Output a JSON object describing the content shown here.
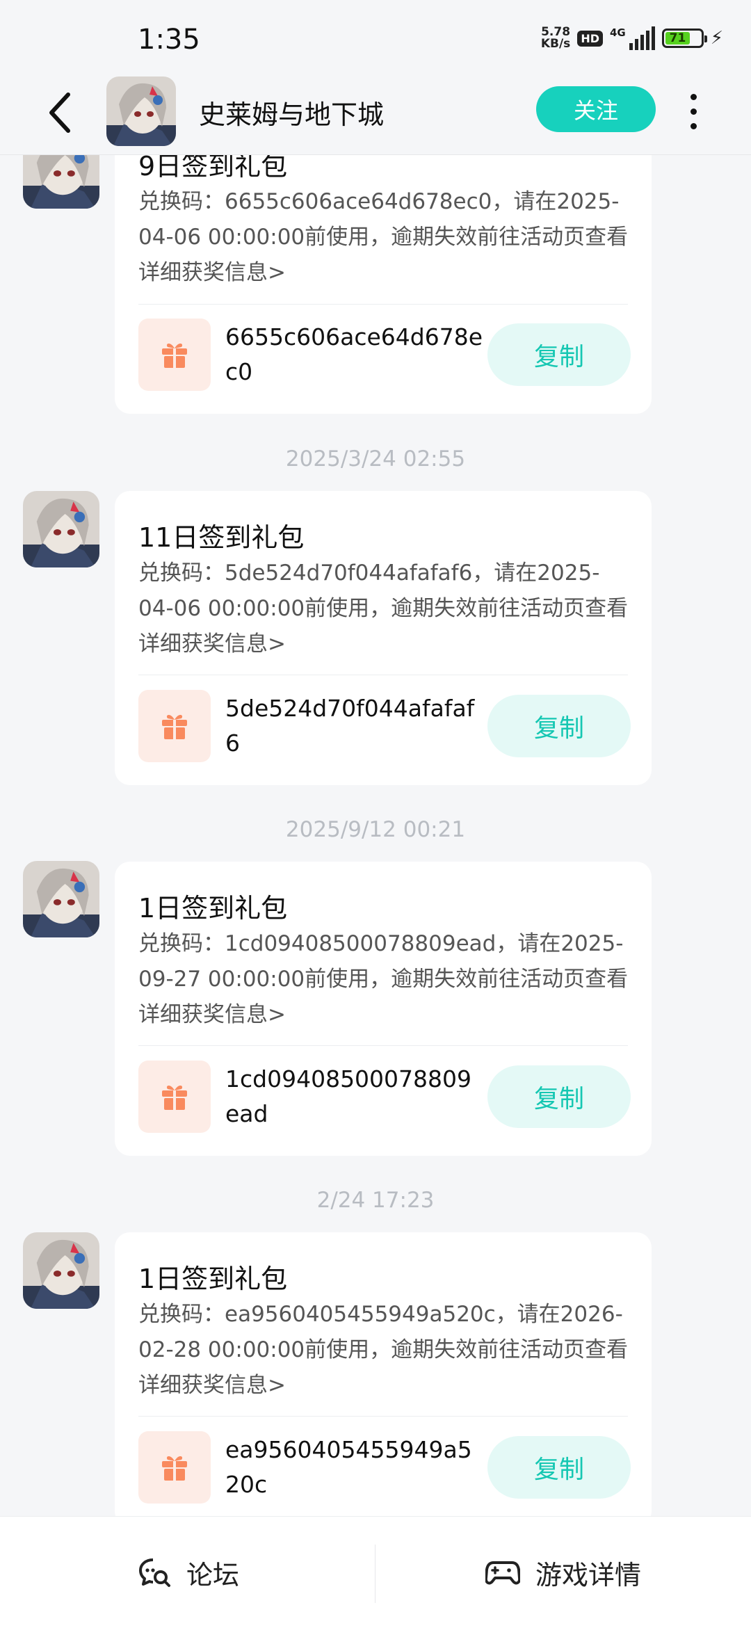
{
  "status_bar": {
    "time": "1:35",
    "speed": "5.78",
    "speed_unit": "KB/s",
    "hd": "HD",
    "network": "4G",
    "battery": "71"
  },
  "header": {
    "title": "史莱姆与地下城",
    "follow_label": "关注"
  },
  "messages": [
    {
      "time": "",
      "title": "9日签到礼包",
      "desc": "兑换码：6655c606ace64d678ec0，请在2025-04-06 00:00:00前使用，逾期失效前往活动页查看详细获奖信息>",
      "code": "6655c606ace64d678ec0",
      "copy_label": "复制"
    },
    {
      "time": "2025/3/24   02:55",
      "title": "11日签到礼包",
      "desc": "兑换码：5de524d70f044afafaf6，请在2025-04-06 00:00:00前使用，逾期失效前往活动页查看详细获奖信息>",
      "code": "5de524d70f044afafaf6",
      "copy_label": "复制"
    },
    {
      "time": "2025/9/12   00:21",
      "title": "1日签到礼包",
      "desc": "兑换码：1cd09408500078809ead，请在2025-09-27 00:00:00前使用，逾期失效前往活动页查看详细获奖信息>",
      "code": "1cd09408500078809ead",
      "copy_label": "复制"
    },
    {
      "time": "2/24   17:23",
      "title": "1日签到礼包",
      "desc": "兑换码：ea9560405455949a520c，请在2026-02-28 00:00:00前使用，逾期失效前往活动页查看详细获奖信息>",
      "code": "ea9560405455949a520c",
      "copy_label": "复制"
    }
  ],
  "bottom_bar": {
    "forum_label": "论坛",
    "game_detail_label": "游戏详情"
  },
  "colors": {
    "accent": "#17d1bd",
    "gift_orange": "#f98a5e",
    "background": "#f5f6f8"
  },
  "icons": {
    "back": "back-arrow-icon",
    "more": "more-vertical-icon",
    "gift": "gift-icon",
    "forum": "forum-chat-icon",
    "game": "gamepad-icon"
  }
}
